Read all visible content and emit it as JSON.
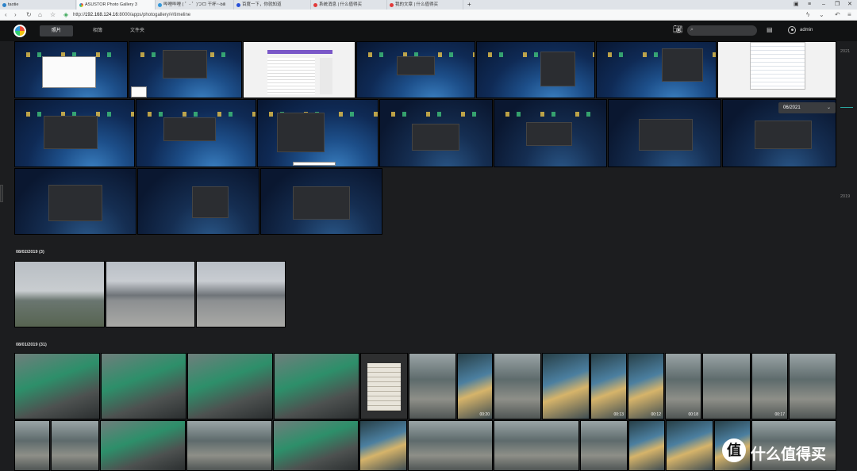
{
  "browser": {
    "tabs": [
      {
        "label": "taotie",
        "color": "#2c82c9"
      },
      {
        "label": "ASUSTOR Photo Gallery 3",
        "color": "#e74c3c"
      },
      {
        "label": "哔哩哔哩 ( ゜- ゜)つロ 干杯~-bili",
        "color": "#3498db"
      },
      {
        "label": "百度一下，你就知道",
        "color": "#2850d8"
      },
      {
        "label": "系统消息 | 什么值得买",
        "color": "#e23a3a"
      },
      {
        "label": "我的文章 | 什么值得买",
        "color": "#e23a3a"
      }
    ],
    "new_tab": "+",
    "url_prefix": "http://",
    "url_host": "192.168.124.16",
    "url_path": ":8000/apps/photogallery/#/timeline"
  },
  "app": {
    "tabs": [
      {
        "label": "照片",
        "active": true
      },
      {
        "label": "相簿",
        "active": false
      },
      {
        "label": "文件夹",
        "active": false
      }
    ],
    "search_placeholder": "",
    "username": "admin"
  },
  "groups": [
    {
      "title": "08/02/2019 (3)"
    },
    {
      "title": "08/01/2019 (31)"
    }
  ],
  "video_durations": [
    "00:20",
    "00:13",
    "00:12",
    "00:18",
    "00:17"
  ],
  "timeline": {
    "years": [
      "2021",
      "2019"
    ],
    "current_date": "06/2021"
  },
  "watermark": {
    "symbol": "值",
    "text": "什么值得买"
  }
}
